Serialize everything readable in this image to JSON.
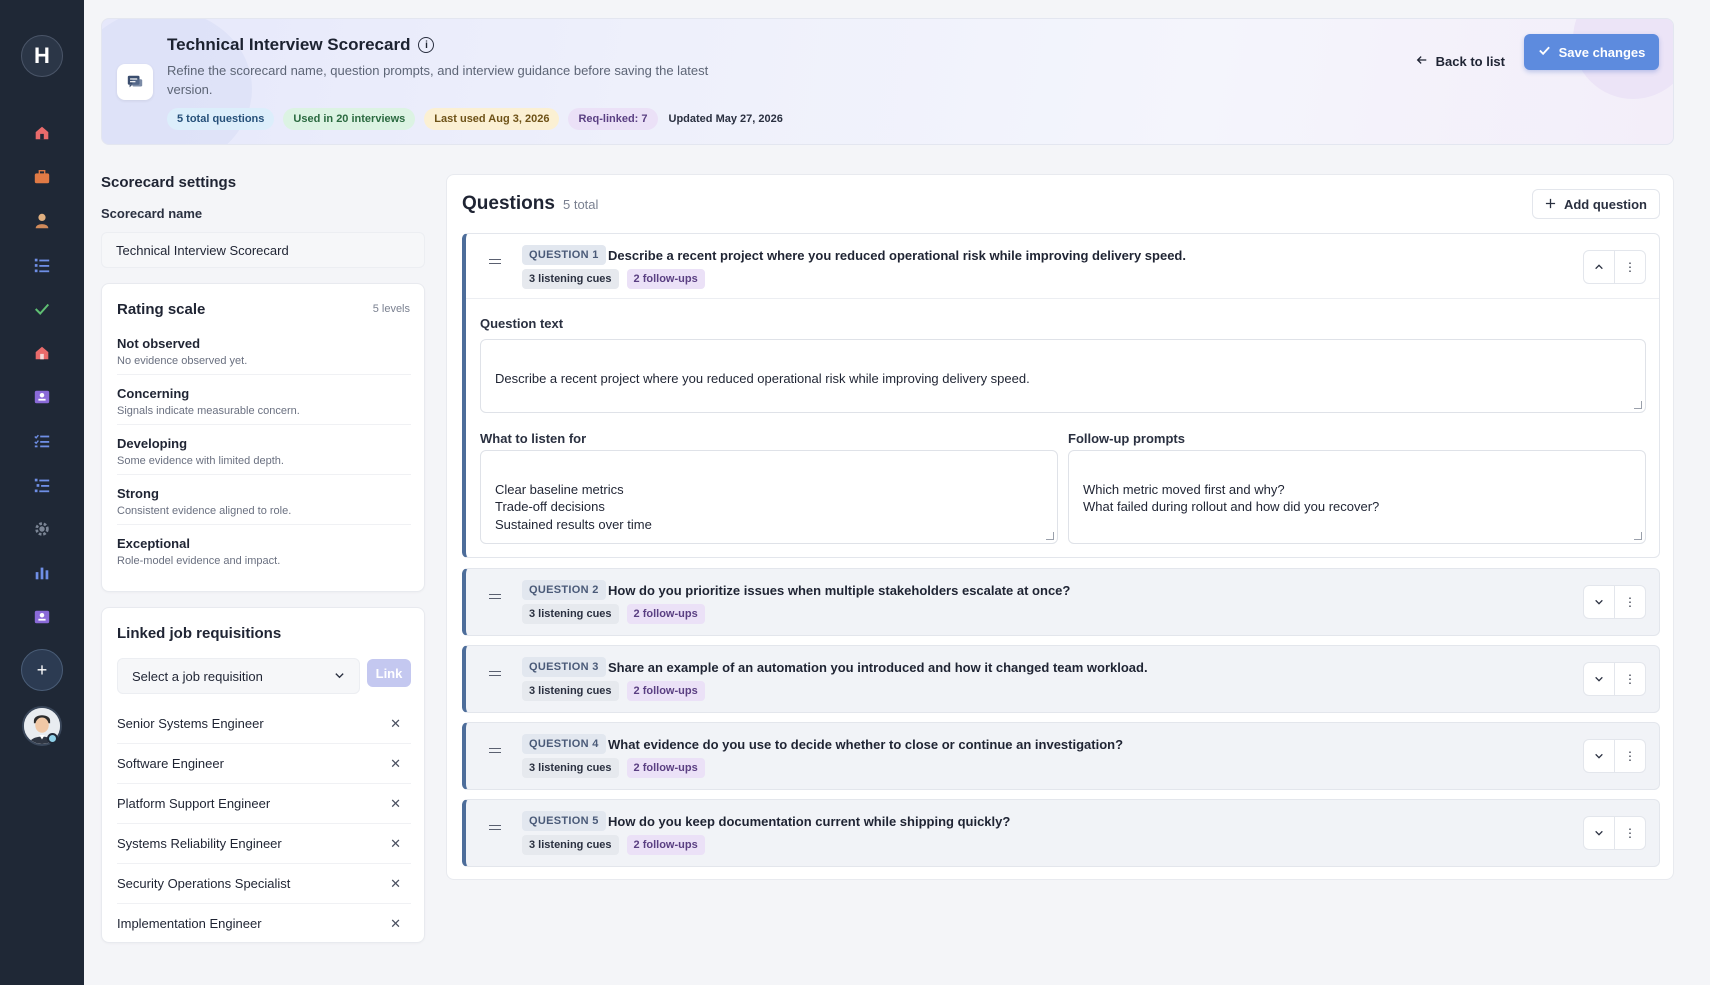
{
  "sidebar": {
    "logo": "H",
    "nav": [
      {
        "name": "home-icon",
        "color": "#e96b6b"
      },
      {
        "name": "briefcase-icon",
        "color": "#e07a45"
      },
      {
        "name": "user-icon",
        "color": "#d9a36b"
      },
      {
        "name": "list-icon",
        "color": "#6f8fe6"
      },
      {
        "name": "check-icon",
        "color": "#5fbf73"
      },
      {
        "name": "building-icon",
        "color": "#e96b6b"
      },
      {
        "name": "id-card-icon",
        "color": "#8a6ad8"
      },
      {
        "name": "checklist-icon",
        "color": "#6f8fe6"
      },
      {
        "name": "tree-list-icon",
        "color": "#6f8fe6"
      },
      {
        "name": "gear-icon",
        "color": "#7b8595"
      },
      {
        "name": "bar-chart-icon",
        "color": "#6f8fe6"
      },
      {
        "name": "profile-card-icon",
        "color": "#8a6ad8"
      }
    ],
    "add_label": "+"
  },
  "header": {
    "title": "Technical Interview Scorecard",
    "subtitle": "Refine the scorecard name, question prompts, and interview guidance before saving the latest version.",
    "badges": {
      "total": "5 total questions",
      "used": "Used in 20 interviews",
      "last_used": "Last used Aug 3, 2026",
      "req_linked": "Req-linked: 7",
      "updated": "Updated May 27, 2026"
    },
    "back_label": "Back to list",
    "save_label": "Save changes"
  },
  "settings": {
    "title": "Scorecard settings",
    "name_label": "Scorecard name",
    "name_value": "Technical Interview Scorecard"
  },
  "rating": {
    "title": "Rating scale",
    "count": "5 levels",
    "levels": [
      {
        "name": "Not observed",
        "desc": "No evidence observed yet."
      },
      {
        "name": "Concerning",
        "desc": "Signals indicate measurable concern."
      },
      {
        "name": "Developing",
        "desc": "Some evidence with limited depth."
      },
      {
        "name": "Strong",
        "desc": "Consistent evidence aligned to role."
      },
      {
        "name": "Exceptional",
        "desc": "Role-model evidence and impact."
      }
    ]
  },
  "requisitions": {
    "title": "Linked job requisitions",
    "select_placeholder": "Select a job requisition",
    "link_label": "Link",
    "items": [
      "Senior Systems Engineer",
      "Software Engineer",
      "Platform Support Engineer",
      "Systems Reliability Engineer",
      "Security Operations Specialist",
      "Implementation Engineer"
    ]
  },
  "questions": {
    "title": "Questions",
    "total": "5 total",
    "add_label": "Add question",
    "question_text_label": "Question text",
    "listen_label": "What to listen for",
    "followup_label": "Follow-up prompts",
    "items": [
      {
        "tag": "QUESTION 1",
        "text": "Describe a recent project where you reduced operational risk while improving delivery speed.",
        "cues": "3 listening cues",
        "followups": "2 follow-ups",
        "listen_for": "Clear baseline metrics\nTrade-off decisions\nSustained results over time",
        "followup_prompts": "Which metric moved first and why?\nWhat failed during rollout and how did you recover?"
      },
      {
        "tag": "QUESTION 2",
        "text": "How do you prioritize issues when multiple stakeholders escalate at once?",
        "cues": "3 listening cues",
        "followups": "2 follow-ups"
      },
      {
        "tag": "QUESTION 3",
        "text": "Share an example of an automation you introduced and how it changed team workload.",
        "cues": "3 listening cues",
        "followups": "2 follow-ups"
      },
      {
        "tag": "QUESTION 4",
        "text": "What evidence do you use to decide whether to close or continue an investigation?",
        "cues": "3 listening cues",
        "followups": "2 follow-ups"
      },
      {
        "tag": "QUESTION 5",
        "text": "How do you keep documentation current while shipping quickly?",
        "cues": "3 listening cues",
        "followups": "2 follow-ups"
      }
    ]
  }
}
